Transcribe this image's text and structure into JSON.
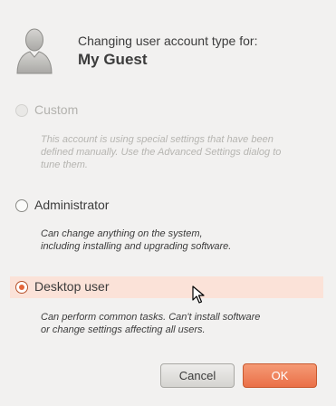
{
  "header": {
    "subtitle": "Changing user account type for:",
    "user_name": "My Guest",
    "avatar_icon": "user-silhouette-icon"
  },
  "options": [
    {
      "id": "custom",
      "label": "Custom",
      "description_lines": [
        "This account is using special settings that have been",
        "defined manually. Use the Advanced Settings dialog to",
        "tune them."
      ],
      "enabled": false,
      "selected": false
    },
    {
      "id": "administrator",
      "label": "Administrator",
      "description_lines": [
        "Can change anything on the system,",
        "including installing and upgrading software."
      ],
      "enabled": true,
      "selected": false
    },
    {
      "id": "desktop_user",
      "label": "Desktop user",
      "description_lines": [
        "Can perform common tasks. Can't install software",
        "or change settings affecting all users."
      ],
      "enabled": true,
      "selected": true
    }
  ],
  "buttons": {
    "cancel_label": "Cancel",
    "ok_label": "OK"
  },
  "colors": {
    "background": "#f2f1f0",
    "selected_row": "#fbe2d8",
    "accent": "#e4663a",
    "ok_button": "#ee7a50"
  }
}
